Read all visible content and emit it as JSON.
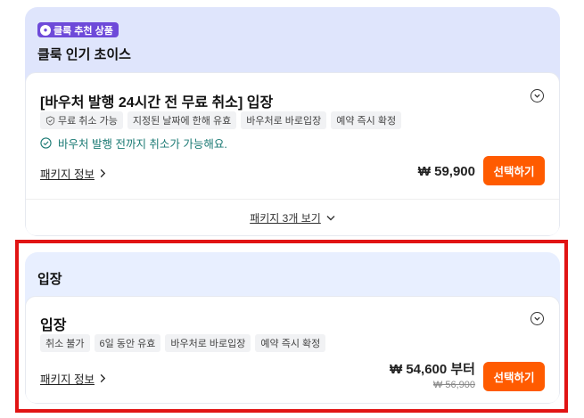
{
  "recommended_section": {
    "badge_label": "클룩 추천 상품",
    "title": "클룩 인기 초이스",
    "option": {
      "title": "[바우처 발행 24시간 전 무료 취소] 입장",
      "tags": [
        "무료 취소 가능",
        "지정된 날짜에 한해 유효",
        "바우처로 바로입장",
        "예약 즉시 확정"
      ],
      "note": "바우처 발행 전까지 취소가 가능해요.",
      "package_link": "패키지 정보",
      "price": "₩ 59,900",
      "select_label": "선택하기"
    },
    "more_label": "패키지 3개 보기"
  },
  "entry_section": {
    "title": "입장",
    "option": {
      "title": "입장",
      "tags": [
        "취소 불가",
        "6일 동안 유효",
        "바우처로 바로입장",
        "예약 즉시 확정"
      ],
      "package_link": "패키지 정보",
      "price": "₩ 54,600 부터",
      "original_price": "₩ 56,900",
      "select_label": "선택하기"
    }
  },
  "colors": {
    "accent": "#ff5b00",
    "badge": "#6e4ad9",
    "highlight_border": "#e11414",
    "note_text": "#1b7a74"
  },
  "icons": {
    "badge": "klook-logo-icon",
    "free_cancel": "shield-check-icon",
    "note": "check-circle-icon"
  }
}
